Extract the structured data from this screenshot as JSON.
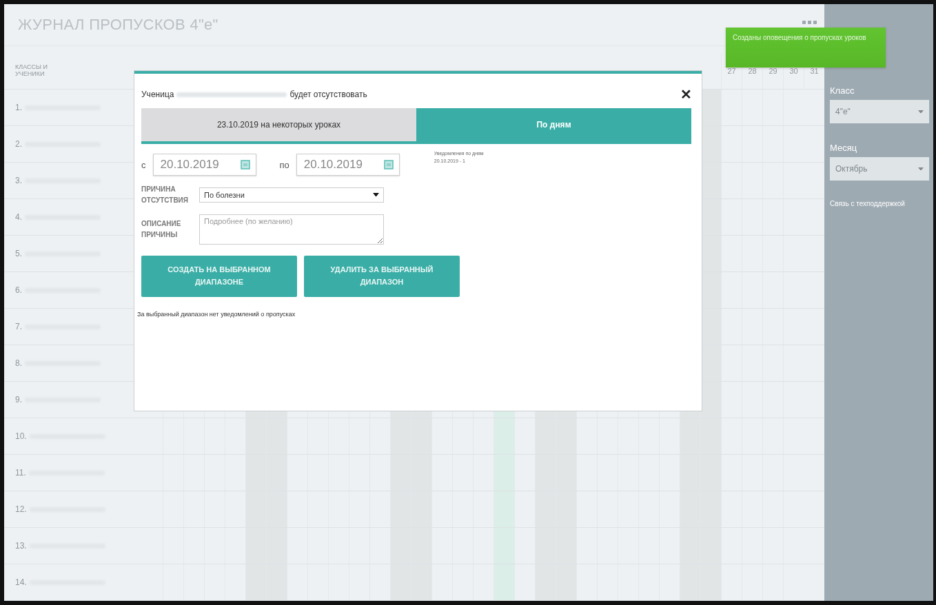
{
  "page": {
    "title": "ЖУРНАЛ ПРОПУСКОВ 4\"е\"",
    "column_header": "КЛАССЫ И УЧЕНИКИ"
  },
  "day_headers": [
    "27",
    "28",
    "29",
    "30",
    "31"
  ],
  "students": [
    {
      "number": "1."
    },
    {
      "number": "2."
    },
    {
      "number": "3."
    },
    {
      "number": "4."
    },
    {
      "number": "5."
    },
    {
      "number": "6."
    },
    {
      "number": "7."
    },
    {
      "number": "8."
    },
    {
      "number": "9."
    },
    {
      "number": "10."
    },
    {
      "number": "11."
    },
    {
      "number": "12."
    },
    {
      "number": "13."
    },
    {
      "number": "14."
    }
  ],
  "sidebar": {
    "class_label": "Класс",
    "class_value": "4\"е\"",
    "month_label": "Месяц",
    "month_value": "Октябрь",
    "support_link": "Связь с техподдержкой"
  },
  "toast": {
    "text": "Созданы оповещения о пропусках уроков"
  },
  "dialog": {
    "title_before": "Ученица",
    "title_after": "будет отсутствовать",
    "close": "✕",
    "tabs": [
      {
        "label": "23.10.2019 на некоторых уроках",
        "selected": false
      },
      {
        "label": "По дням",
        "selected": true
      }
    ],
    "from_label": "с",
    "from_value": "20.10.2019",
    "to_label": "по",
    "to_value": "20.10.2019",
    "notes_title": "Уведомления по дням",
    "notes": [
      "20.10.2019 - 1"
    ],
    "reason_label": "ПРИЧИНА ОТСУТСТВИЯ",
    "reason_value": "По болезни",
    "description_label": "ОПИСАНИЕ ПРИЧИНЫ",
    "description_placeholder": "Подробнее (по желанию)",
    "buttons": [
      "СОЗДАТЬ НА ВЫБРАННОМ ДИАПАЗОНЕ",
      "УДАЛИТЬ ЗА ВЫБРАННЫЙ ДИАПАЗОН"
    ],
    "status": "За выбранный диапазон нет уведомлений о пропусках"
  }
}
